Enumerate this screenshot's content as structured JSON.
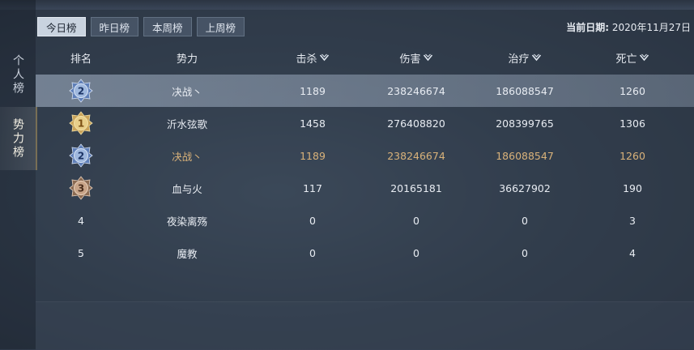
{
  "side_tabs": [
    {
      "label": "个人榜",
      "active": false
    },
    {
      "label": "势力榜",
      "active": true
    }
  ],
  "tabs": [
    {
      "label": "今日榜",
      "active": true
    },
    {
      "label": "昨日榜",
      "active": false
    },
    {
      "label": "本周榜",
      "active": false
    },
    {
      "label": "上周榜",
      "active": false
    }
  ],
  "date": {
    "label": "当前日期:",
    "value": "2020年11月27日"
  },
  "columns": [
    "排名",
    "势力",
    "击杀",
    "伤害",
    "治疗",
    "死亡"
  ],
  "sortable": [
    false,
    false,
    true,
    true,
    true,
    true
  ],
  "rows": [
    {
      "rank": "2",
      "badge": "silver",
      "faction": "决战丶",
      "kills": "1189",
      "damage": "238246674",
      "heal": "186088547",
      "deaths": "1260",
      "style": "selected"
    },
    {
      "rank": "1",
      "badge": "gold",
      "faction": "沂水弦歌",
      "kills": "1458",
      "damage": "276408820",
      "heal": "208399765",
      "deaths": "1306",
      "style": "normal"
    },
    {
      "rank": "2",
      "badge": "silver",
      "faction": "决战丶",
      "kills": "1189",
      "damage": "238246674",
      "heal": "186088547",
      "deaths": "1260",
      "style": "gold"
    },
    {
      "rank": "3",
      "badge": "bronze",
      "faction": "血与火",
      "kills": "117",
      "damage": "20165181",
      "heal": "36627902",
      "deaths": "190",
      "style": "normal"
    },
    {
      "rank": "4",
      "badge": "none",
      "faction": "夜染离殇",
      "kills": "0",
      "damage": "0",
      "heal": "0",
      "deaths": "3",
      "style": "normal"
    },
    {
      "rank": "5",
      "badge": "none",
      "faction": "魔教",
      "kills": "0",
      "damage": "0",
      "heal": "0",
      "deaths": "4",
      "style": "normal"
    }
  ],
  "colors": {
    "gold_text": "#d9b27a",
    "active_tab_bg": "#c9d3df",
    "accent": "#d8b36a"
  }
}
